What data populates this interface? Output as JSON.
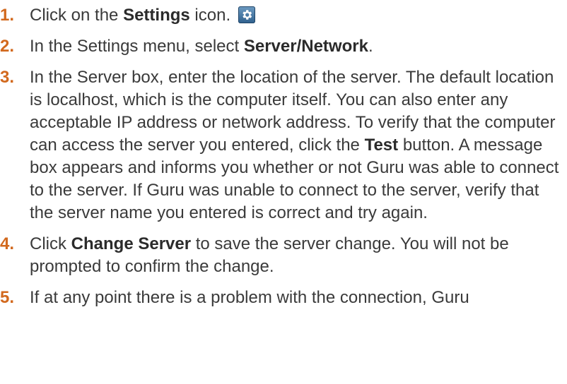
{
  "accent_color": "#d2691e",
  "steps": [
    {
      "number": "1.",
      "parts": [
        {
          "t": "Click on the "
        },
        {
          "t": "Settings",
          "b": true
        },
        {
          "t": " icon."
        }
      ],
      "icon": "settings-gear-icon"
    },
    {
      "number": "2.",
      "parts": [
        {
          "t": "In the Settings menu, select "
        },
        {
          "t": "Server/Network",
          "b": true
        },
        {
          "t": "."
        }
      ]
    },
    {
      "number": "3.",
      "parts": [
        {
          "t": "In the Server box, enter the location of the server.  The default location is localhost, which is the computer itself. You can also enter any acceptable IP address or network address.  To verify that the computer can access the server you entered, click the "
        },
        {
          "t": "Test",
          "b": true
        },
        {
          "t": " button. A message box appears and informs you whether or not Guru was able to connect to the server. If Guru was unable to connect to the server, verify that the server name you entered is correct and try again."
        }
      ]
    },
    {
      "number": "4.",
      "parts": [
        {
          "t": "Click "
        },
        {
          "t": "Change Server",
          "b": true
        },
        {
          "t": " to save the server change. You will not be prompted to confirm the change."
        }
      ]
    },
    {
      "number": "5.",
      "parts": [
        {
          "t": "If at any point there is a problem with the connection, Guru"
        }
      ]
    }
  ]
}
